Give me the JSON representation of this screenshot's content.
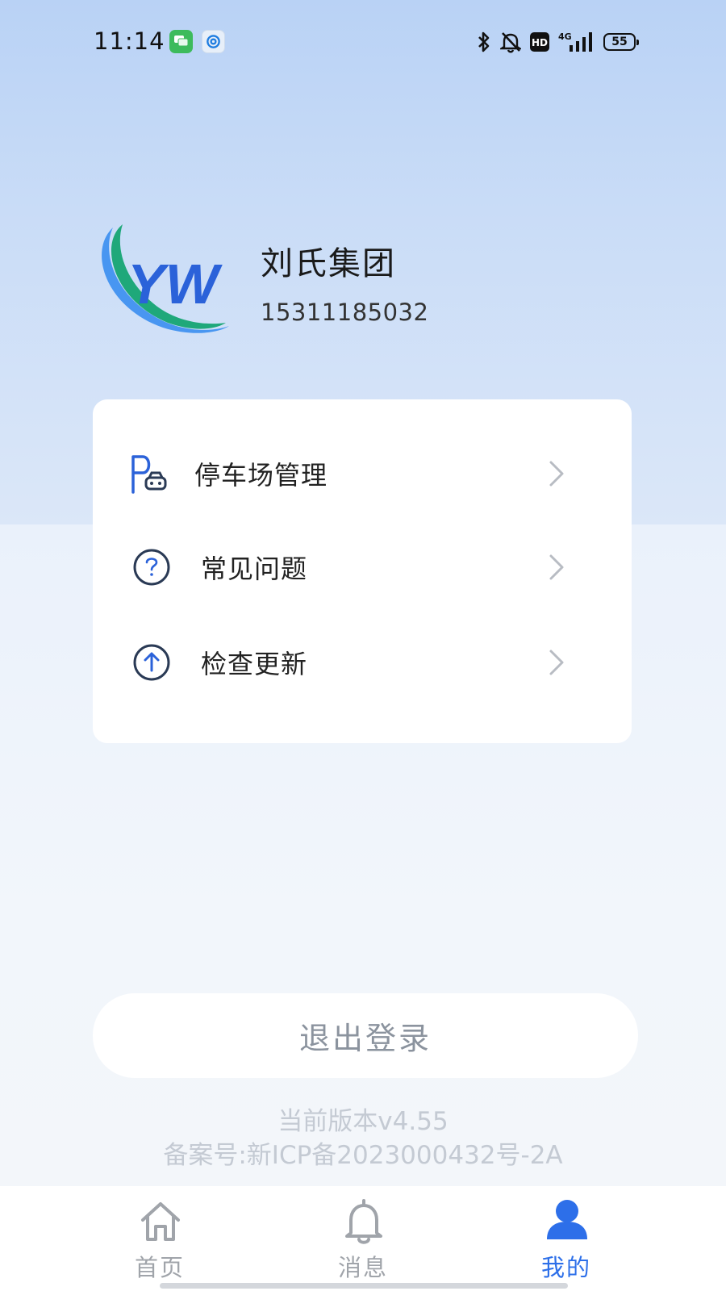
{
  "status_bar": {
    "time": "11:14",
    "battery": "55",
    "icons": [
      "messages-app-icon",
      "at-app-icon",
      "bluetooth-icon",
      "mute-bell-icon",
      "hd-icon",
      "4g-signal-icon",
      "battery-icon"
    ]
  },
  "profile": {
    "name": "刘氏集团",
    "phone": "15311185032",
    "logo_text": "YW"
  },
  "menu": {
    "items": [
      {
        "label": "停车场管理",
        "icon": "parking-icon"
      },
      {
        "label": "常见问题",
        "icon": "question-circle-icon"
      },
      {
        "label": "检查更新",
        "icon": "upload-circle-icon"
      }
    ]
  },
  "logout_label": "退出登录",
  "footer": {
    "version": "当前版本v4.55",
    "icp": "备案号:新ICP备2023000432号-2A"
  },
  "tabs": [
    {
      "label": "首页",
      "icon": "home-icon",
      "active": false
    },
    {
      "label": "消息",
      "icon": "bell-icon",
      "active": false
    },
    {
      "label": "我的",
      "icon": "user-icon",
      "active": true
    }
  ],
  "colors": {
    "accent": "#2d6fe9",
    "hero_top": "#b9d2f5",
    "muted_text": "#c4cad3"
  }
}
